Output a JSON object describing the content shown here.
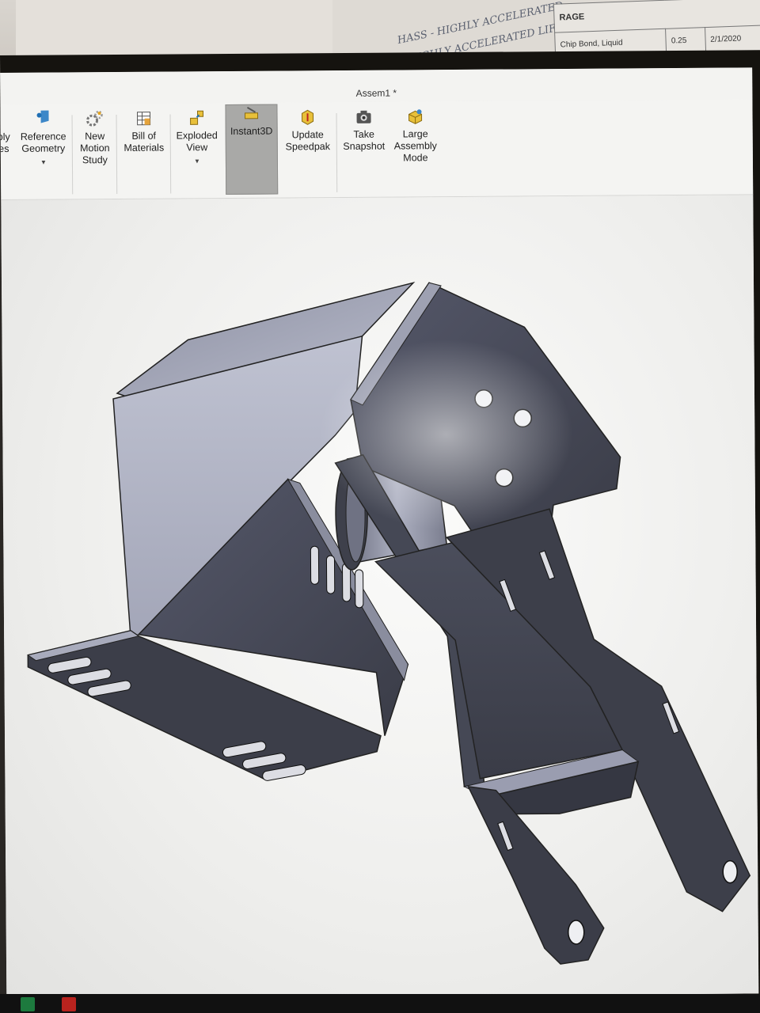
{
  "desk": {
    "handwriting_line1": "HASS - HIGHLY ACCELERATED",
    "handwriting_line2": "- HIGHLY ACCELERATED LIFE",
    "table_header": "RAGE",
    "table_row": [
      "Chip Bond, Liquid",
      "0.25",
      "2/1/2020"
    ]
  },
  "window": {
    "title": "Assem1 *"
  },
  "ribbon": {
    "buttons": [
      {
        "label": "bly\nes",
        "icon": "assembly-features-icon"
      },
      {
        "label": "Reference\nGeometry",
        "icon": "reference-geometry-icon",
        "has_dropdown": true
      },
      {
        "label": "New\nMotion\nStudy",
        "icon": "motion-study-icon"
      },
      {
        "label": "Bill of\nMaterials",
        "icon": "bill-of-materials-icon"
      },
      {
        "label": "Exploded\nView",
        "icon": "exploded-view-icon",
        "has_dropdown": true
      },
      {
        "label": "Instant3D",
        "icon": "instant3d-icon",
        "active": true
      },
      {
        "label": "Update\nSpeedpak",
        "icon": "speedpak-icon"
      },
      {
        "label": "Take\nSnapshot",
        "icon": "camera-icon"
      },
      {
        "label": "Large\nAssembly\nMode",
        "icon": "large-assembly-icon"
      }
    ],
    "dropdown_glyph": "▼"
  },
  "view_toolbar": {
    "icons": [
      "zoom-to-fit-icon",
      "zoom-to-area-icon",
      "previous-view-icon",
      "section-view-icon",
      "dynamic-annotation-icon",
      "view-orientation-icon",
      "display-style-icon",
      "hide-show-items-icon",
      "edit-appearance-icon",
      "apply-scene-icon",
      "view-settings-icon"
    ],
    "dropdown_glyph": "▾"
  },
  "colors": {
    "part_dark": "#3d3f49",
    "part_mid": "#5a5d6b",
    "part_light": "#9a9db0",
    "part_highlight": "#c4c7d6",
    "active_button": "#a9a9a7"
  }
}
